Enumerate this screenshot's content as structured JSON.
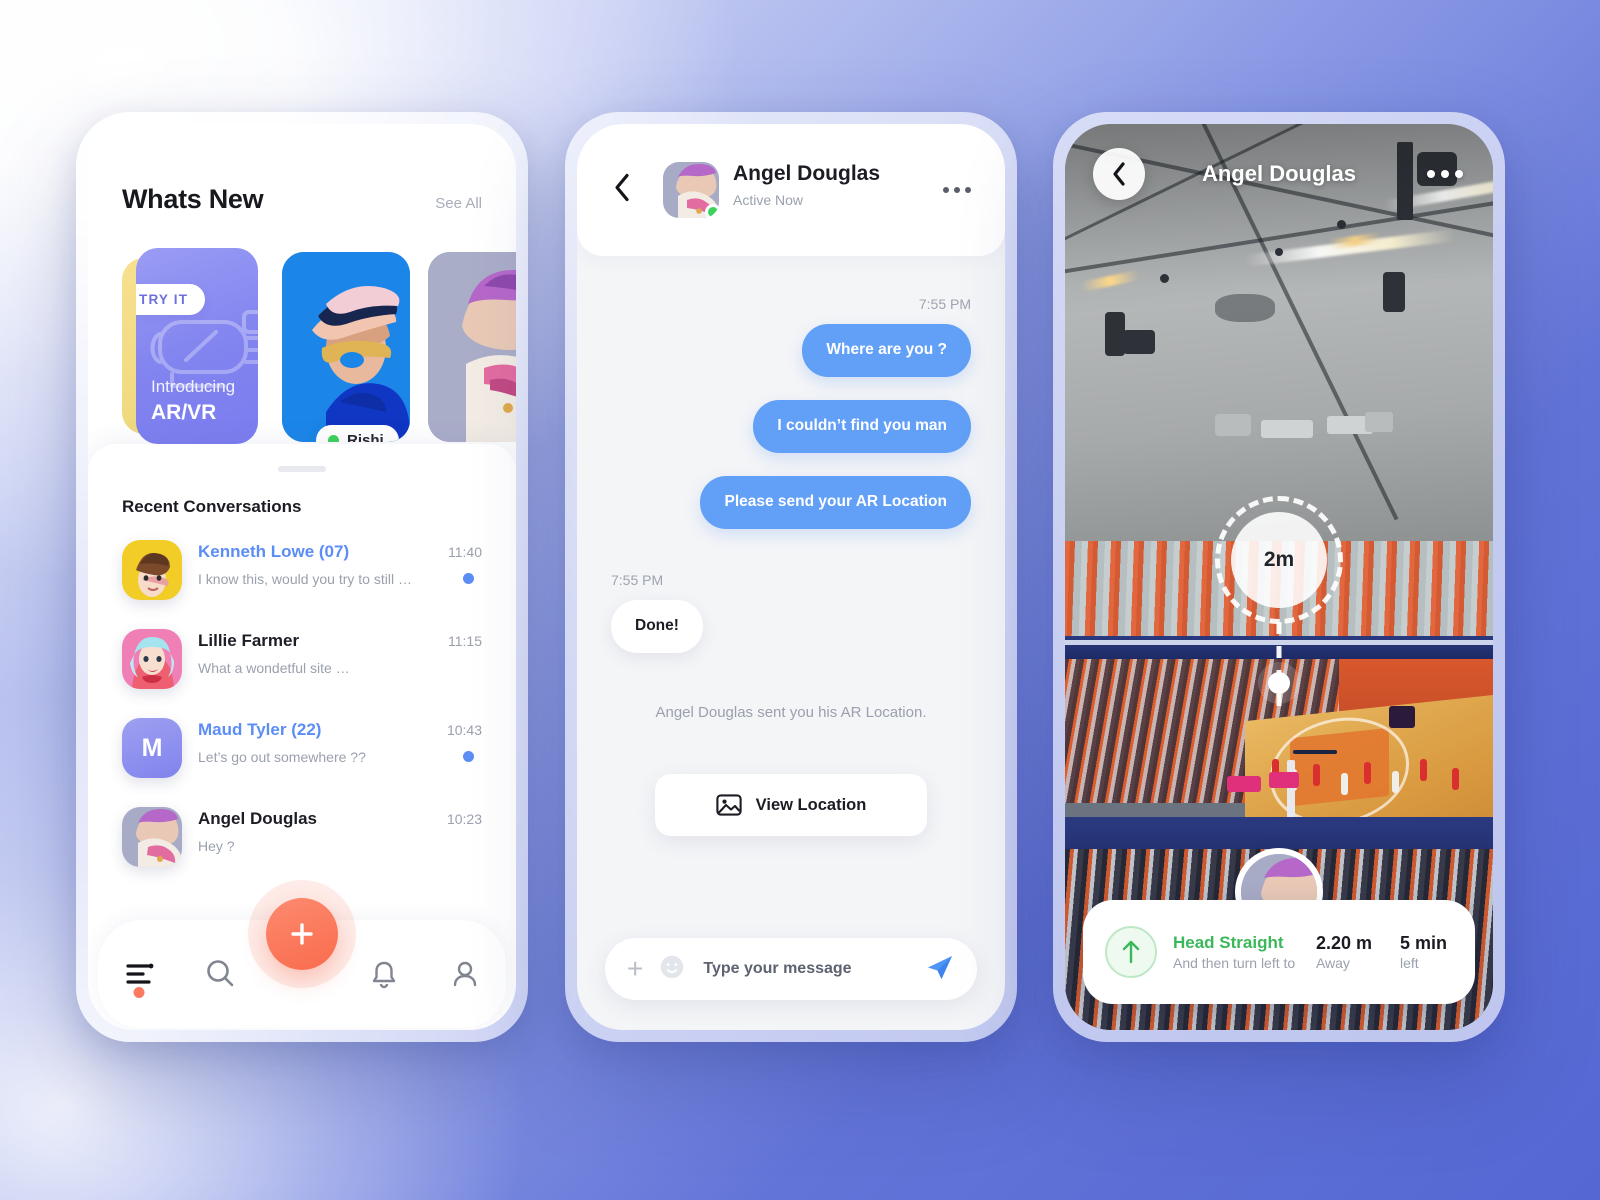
{
  "theme": {
    "background_gradient_start": "#eef1fb",
    "background_gradient_end": "#5467d3",
    "accent_blue": "#5b8df5",
    "bubble_blue": "#62a0f8",
    "accent_coral": "#f96c4d",
    "online_green": "#3cd35c",
    "arvr_purple": "#8183ef",
    "arvr_yellow": "#f7e08f",
    "nav_green": "#3bb85a"
  },
  "phone1": {
    "header": {
      "title": "Whats New",
      "see_all": "See All"
    },
    "stories": [
      {
        "type": "promo",
        "badge": "TRY IT",
        "line1": "Introducing",
        "line2": "AR/VR",
        "icon": "vr-headset-icon"
      },
      {
        "type": "person",
        "name": "Rishi",
        "online": true
      },
      {
        "type": "person",
        "name": "",
        "online": true
      }
    ],
    "sheet": {
      "title": "Recent Conversations",
      "conversations": [
        {
          "name": "Kenneth Lowe (07)",
          "snippet": "I know this, would you try to still …",
          "time": "11:40",
          "unread": true,
          "avatar_kind": "photo-yellow",
          "avatar_letter": ""
        },
        {
          "name": "Lillie Farmer",
          "snippet": "What a wondetful site …",
          "time": "11:15",
          "unread": false,
          "avatar_kind": "photo-pink",
          "avatar_letter": ""
        },
        {
          "name": "Maud Tyler (22)",
          "snippet": "Let’s go out somewhere ??",
          "time": "10:43",
          "unread": true,
          "avatar_kind": "letter",
          "avatar_letter": "M"
        },
        {
          "name": "Angel Douglas",
          "snippet": "Hey ?",
          "time": "10:23",
          "unread": false,
          "avatar_kind": "photo-lavender",
          "avatar_letter": ""
        }
      ]
    },
    "tabbar": {
      "items": [
        {
          "icon": "feed-list-icon",
          "active": true
        },
        {
          "icon": "search-icon",
          "active": false
        },
        {
          "icon": "bell-icon",
          "active": false
        },
        {
          "icon": "person-icon",
          "active": false
        }
      ],
      "fab_icon": "plus-icon"
    }
  },
  "phone2": {
    "header": {
      "back_icon": "chevron-left-icon",
      "name": "Angel Douglas",
      "status": "Active Now",
      "more_icon": "more-horizontal-icon",
      "online": true
    },
    "messages": [
      {
        "side": "out",
        "time": "7:55 PM",
        "text": "Where are you ?"
      },
      {
        "side": "out",
        "time": "",
        "text": "I couldn’t find you man"
      },
      {
        "side": "out",
        "time": "",
        "text": "Please send your AR Location"
      },
      {
        "side": "in",
        "time": "7:55 PM",
        "text": "Done!"
      }
    ],
    "system_note": "Angel Douglas sent you his AR Location.",
    "view_location_button": {
      "label": "View Location",
      "icon": "image-icon"
    },
    "composer": {
      "plus_icon": "plus-icon",
      "emoji_icon": "smiley-icon",
      "placeholder": "Type your message",
      "value": "",
      "send_icon": "send-paper-plane-icon"
    }
  },
  "phone3": {
    "header": {
      "back_icon": "chevron-left-icon",
      "name": "Angel Douglas",
      "more_icon": "more-horizontal-icon"
    },
    "ar_marker": {
      "distance_label": "2m"
    },
    "nav_card": {
      "direction_icon": "arrow-up-icon",
      "heading": "Head Straight",
      "subheading": "And then turn left to",
      "metrics": [
        {
          "value": "2.20 m",
          "label": "Away"
        },
        {
          "value": "5 min",
          "label": "left"
        }
      ]
    }
  }
}
